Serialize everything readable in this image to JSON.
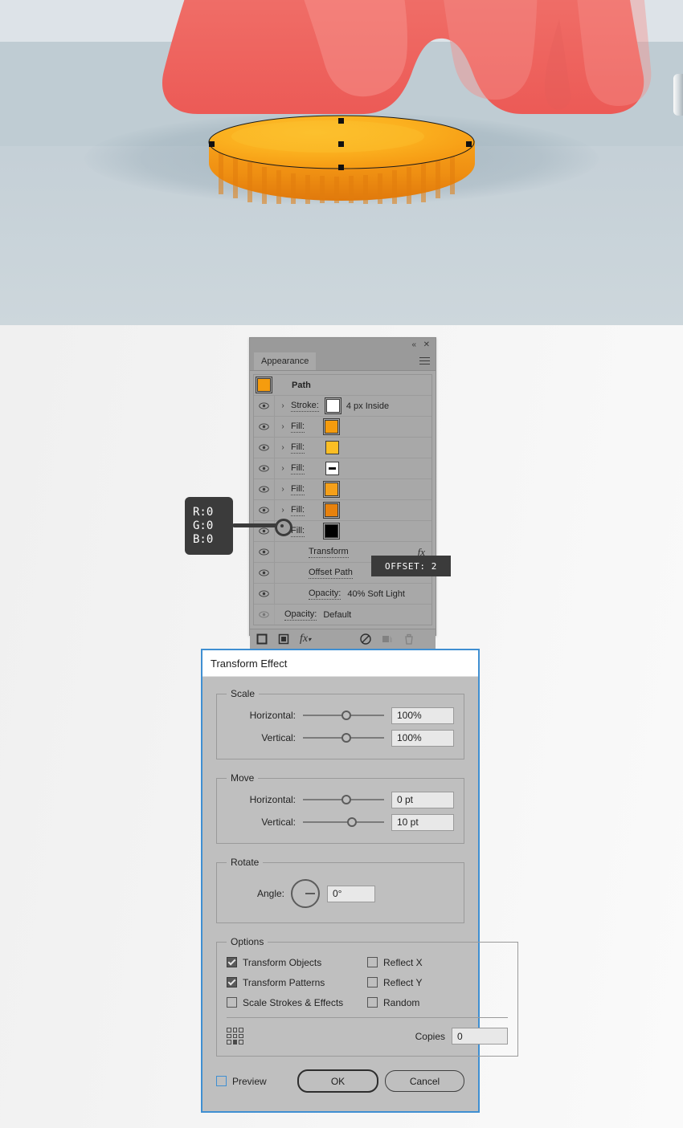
{
  "artboard": {
    "description": "Adobe Illustrator artboard showing a gold coin with selection anchors beneath a large red rounded shape",
    "colors": {
      "sky": "#dde3e8",
      "ground": "#c5d0d7",
      "ground_shade": "#bfccd3",
      "mitten_base": "#ee6161",
      "mitten_light": "#f28a85",
      "coin_top_light": "#fbb623",
      "coin_top_mid": "#f7a41c",
      "coin_edge": "#e07e12",
      "coin_rim": "#f49a1a"
    }
  },
  "appearance_panel": {
    "tab_label": "Appearance",
    "collapse_icon": "«",
    "close_icon": "✕",
    "menu_icon": "panel-menu-icon",
    "target_label": "Path",
    "rows": [
      {
        "id": "stroke",
        "label": "Stroke:",
        "visible": true,
        "expandable": true,
        "swatch": "#ffffff",
        "swatch_selected": false,
        "meta": "4 px   Inside"
      },
      {
        "id": "fill-1",
        "label": "Fill:",
        "visible": true,
        "expandable": true,
        "swatch": "#f59c0e",
        "swatch_selected": true,
        "meta": ""
      },
      {
        "id": "fill-2",
        "label": "Fill:",
        "visible": true,
        "expandable": true,
        "swatch": "#fbbe24",
        "swatch_selected": false,
        "meta": ""
      },
      {
        "id": "fill-3",
        "label": "Fill:",
        "visible": true,
        "expandable": true,
        "swatch": "gradient-dash",
        "swatch_selected": false,
        "meta": ""
      },
      {
        "id": "fill-4",
        "label": "Fill:",
        "visible": true,
        "expandable": true,
        "swatch": "#f5a01a",
        "swatch_selected": false,
        "meta": ""
      },
      {
        "id": "fill-5",
        "label": "Fill:",
        "visible": true,
        "expandable": true,
        "swatch": "#e8820d",
        "swatch_selected": false,
        "meta": ""
      },
      {
        "id": "fill-6",
        "label": "Fill:",
        "visible": true,
        "expandable": false,
        "swatch": "#000000",
        "swatch_selected": false,
        "meta": ""
      }
    ],
    "effect_rows": [
      {
        "id": "transform",
        "label": "Transform",
        "visible": true,
        "fx": "fx",
        "meta": ""
      },
      {
        "id": "offset-path",
        "label": "Offset Path",
        "visible": true,
        "fx": "",
        "meta": ""
      },
      {
        "id": "opacity-1",
        "label": "Opacity:",
        "visible": true,
        "fx": "",
        "meta": "40% Soft Light"
      },
      {
        "id": "opacity-2",
        "label": "Opacity:",
        "visible": false,
        "fx": "",
        "meta": "Default"
      }
    ],
    "footer_tools": [
      "add-new-stroke",
      "add-new-fill",
      "add-new-effect",
      "clear-appearance",
      "duplicate-selected-item",
      "delete-selected-item"
    ]
  },
  "rgb_callout": {
    "r": "R:0",
    "g": "G:0",
    "b": "B:0"
  },
  "tooltip": {
    "offset": "OFFSET:  2"
  },
  "dialog": {
    "title": "Transform Effect",
    "scale": {
      "legend": "Scale",
      "horizontal_label": "Horizontal:",
      "horizontal_value": "100%",
      "horizontal_knob_pct": 50,
      "vertical_label": "Vertical:",
      "vertical_value": "100%",
      "vertical_knob_pct": 50
    },
    "move": {
      "legend": "Move",
      "horizontal_label": "Horizontal:",
      "horizontal_value": "0 pt",
      "horizontal_knob_pct": 50,
      "vertical_label": "Vertical:",
      "vertical_value": "10 pt",
      "vertical_knob_pct": 56
    },
    "rotate": {
      "legend": "Rotate",
      "angle_label": "Angle:",
      "angle_value": "0°"
    },
    "options": {
      "legend": "Options",
      "items": [
        {
          "label": "Transform Objects",
          "checked": true
        },
        {
          "label": "Reflect X",
          "checked": false
        },
        {
          "label": "Transform Patterns",
          "checked": true
        },
        {
          "label": "Reflect Y",
          "checked": false
        },
        {
          "label": "Scale Strokes & Effects",
          "checked": false
        },
        {
          "label": "Random",
          "checked": false
        }
      ],
      "copies_label": "Copies",
      "copies_value": "0",
      "reference_point": "bottom-center"
    },
    "footer": {
      "preview_label": "Preview",
      "preview_checked": false,
      "ok_label": "OK",
      "cancel_label": "Cancel"
    },
    "accent_color": "#3f8fd2"
  }
}
